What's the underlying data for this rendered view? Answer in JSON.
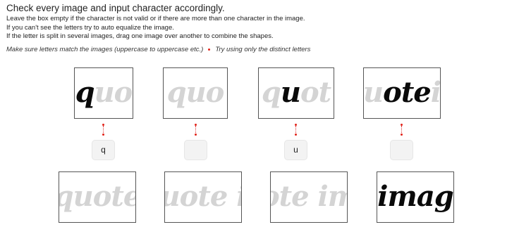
{
  "header": {
    "title": "Check every image and input character accordingly.",
    "instructions": [
      "Leave the box empty if the character is not valid or if there are more than one character in the image.",
      "If you can't see the letters try to auto equalize the image.",
      "If the letter is split in several images, drag one image over another to combine the shapes."
    ],
    "tip_1": "Make sure letters match the images (uppercase to uppercase etc.)",
    "tip_2": "Try using only the distinct letters"
  },
  "top_images": [
    {
      "dark": "q",
      "faded": "uo",
      "icon": "captcha-segment-image"
    },
    {
      "dark": "",
      "faded": "quo",
      "icon": "captcha-segment-image"
    },
    {
      "dark_prefix_faded": "q",
      "dark": "u",
      "faded": "ot",
      "icon": "captcha-segment-image"
    },
    {
      "faded_prefix": "u",
      "dark": "ote",
      "faded": "i",
      "icon": "captcha-segment-image"
    }
  ],
  "inputs": [
    {
      "value": "q"
    },
    {
      "value": ""
    },
    {
      "value": "u"
    },
    {
      "value": ""
    }
  ],
  "bottom_images": [
    {
      "dark": "",
      "faded": "quote"
    },
    {
      "dark": "",
      "faded": "uote i"
    },
    {
      "dark": "",
      "faded": "ote im"
    },
    {
      "dark": "imag",
      "faded": ""
    }
  ]
}
